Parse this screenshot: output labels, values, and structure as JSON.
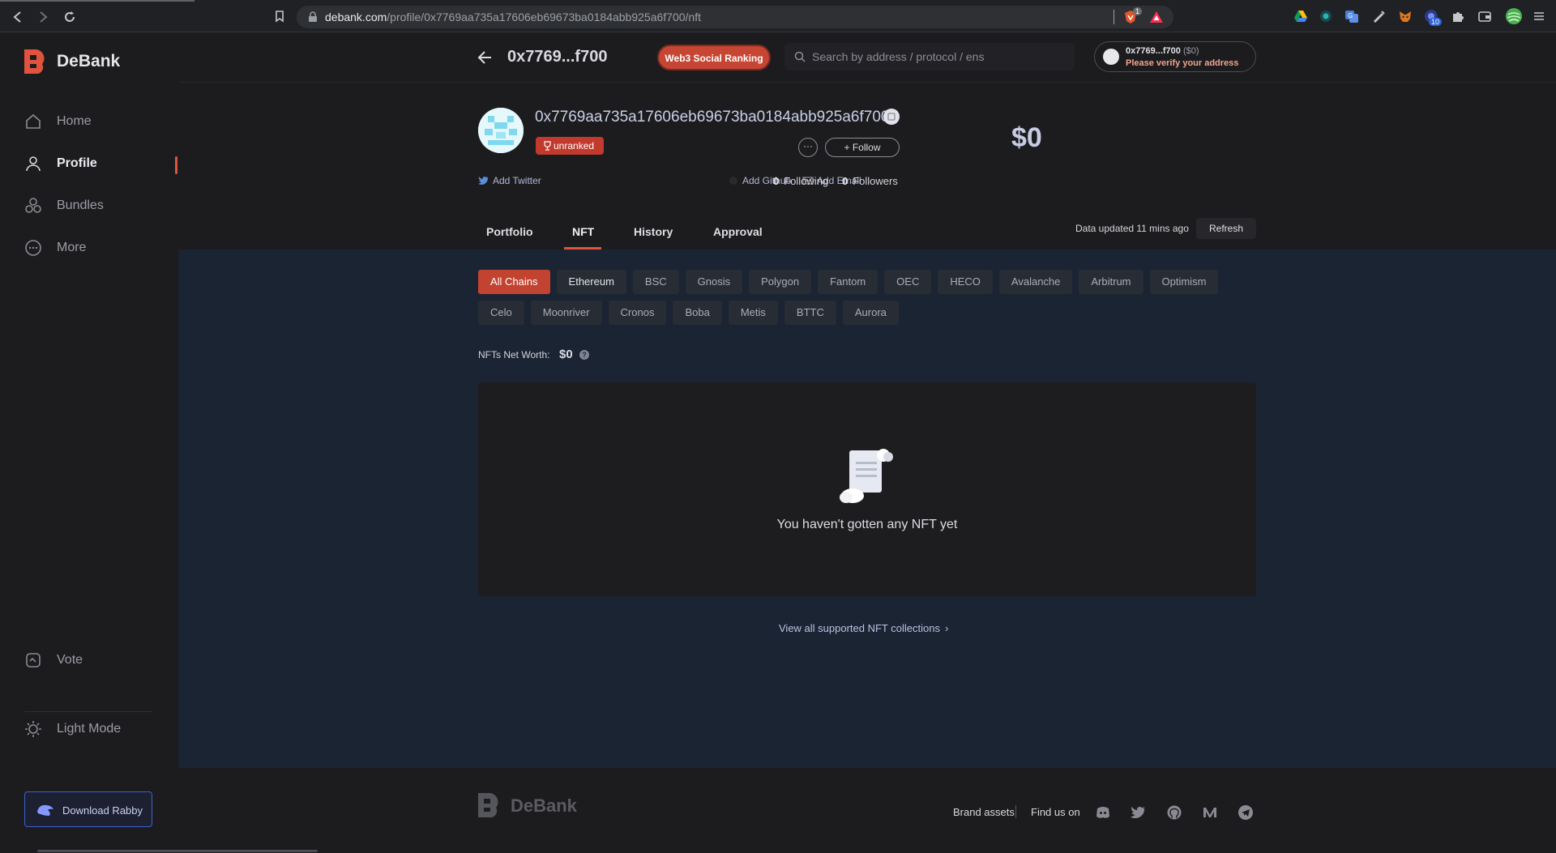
{
  "browser": {
    "url_domain": "debank.com",
    "url_path": "/profile/0x7769aa735a17606eb69673ba0184abb925a6f700/nft",
    "brave_shield_count": "1",
    "extension_badge": "10"
  },
  "sidebar": {
    "brand": "DeBank",
    "items": [
      {
        "label": "Home",
        "icon": "home-icon"
      },
      {
        "label": "Profile",
        "icon": "user-icon"
      },
      {
        "label": "Bundles",
        "icon": "bundles-icon"
      },
      {
        "label": "More",
        "icon": "more-icon"
      }
    ],
    "vote_label": "Vote",
    "light_mode_label": "Light Mode",
    "download_label": "Download Rabby"
  },
  "header": {
    "short_address": "0x7769...f700",
    "badge_label": "Web3 Social Ranking",
    "search_placeholder": "Search by address / protocol / ens",
    "wallet_address": "0x7769...f700",
    "wallet_value": "($0)",
    "wallet_verify": "Please verify your address"
  },
  "profile": {
    "full_address": "0x7769aa735a17606eb69673ba0184abb925a6f700",
    "rank_label": "unranked",
    "more_label": "···",
    "follow_label": "+ Follow",
    "net_worth": "$0",
    "add_twitter": "Add Twitter",
    "add_github": "Add Github",
    "add_email": "Add Email",
    "following_count": "0",
    "following_label": "Following",
    "followers_count": "0",
    "followers_label": "Followers",
    "tabs": [
      "Portfolio",
      "NFT",
      "History",
      "Approval"
    ],
    "active_tab": "NFT",
    "updated_text": "Data updated 11 mins ago",
    "refresh_label": "Refresh"
  },
  "nft": {
    "chains_row1": [
      "All Chains",
      "Ethereum",
      "BSC",
      "Gnosis",
      "Polygon",
      "Fantom",
      "OEC",
      "HECO",
      "Avalanche",
      "Arbitrum",
      "Optimism"
    ],
    "chains_row2": [
      "Celo",
      "Moonriver",
      "Cronos",
      "Boba",
      "Metis",
      "BTTC",
      "Aurora"
    ],
    "selected_chain": "All Chains",
    "net_worth_label": "NFTs Net Worth:",
    "net_worth_value": "$0",
    "empty_text": "You haven't gotten any NFT yet",
    "view_all_label": "View all supported NFT collections"
  },
  "footer": {
    "brand": "DeBank",
    "brand_assets": "Brand assets",
    "find_us": "Find us on",
    "social_icons": [
      "discord-icon",
      "twitter-icon",
      "github-icon",
      "medium-icon",
      "telegram-icon"
    ]
  },
  "colors": {
    "accent": "#e0533d",
    "badge_red": "#c64533",
    "main_bg": "#1b2432",
    "page_bg": "#1c1c1f"
  }
}
